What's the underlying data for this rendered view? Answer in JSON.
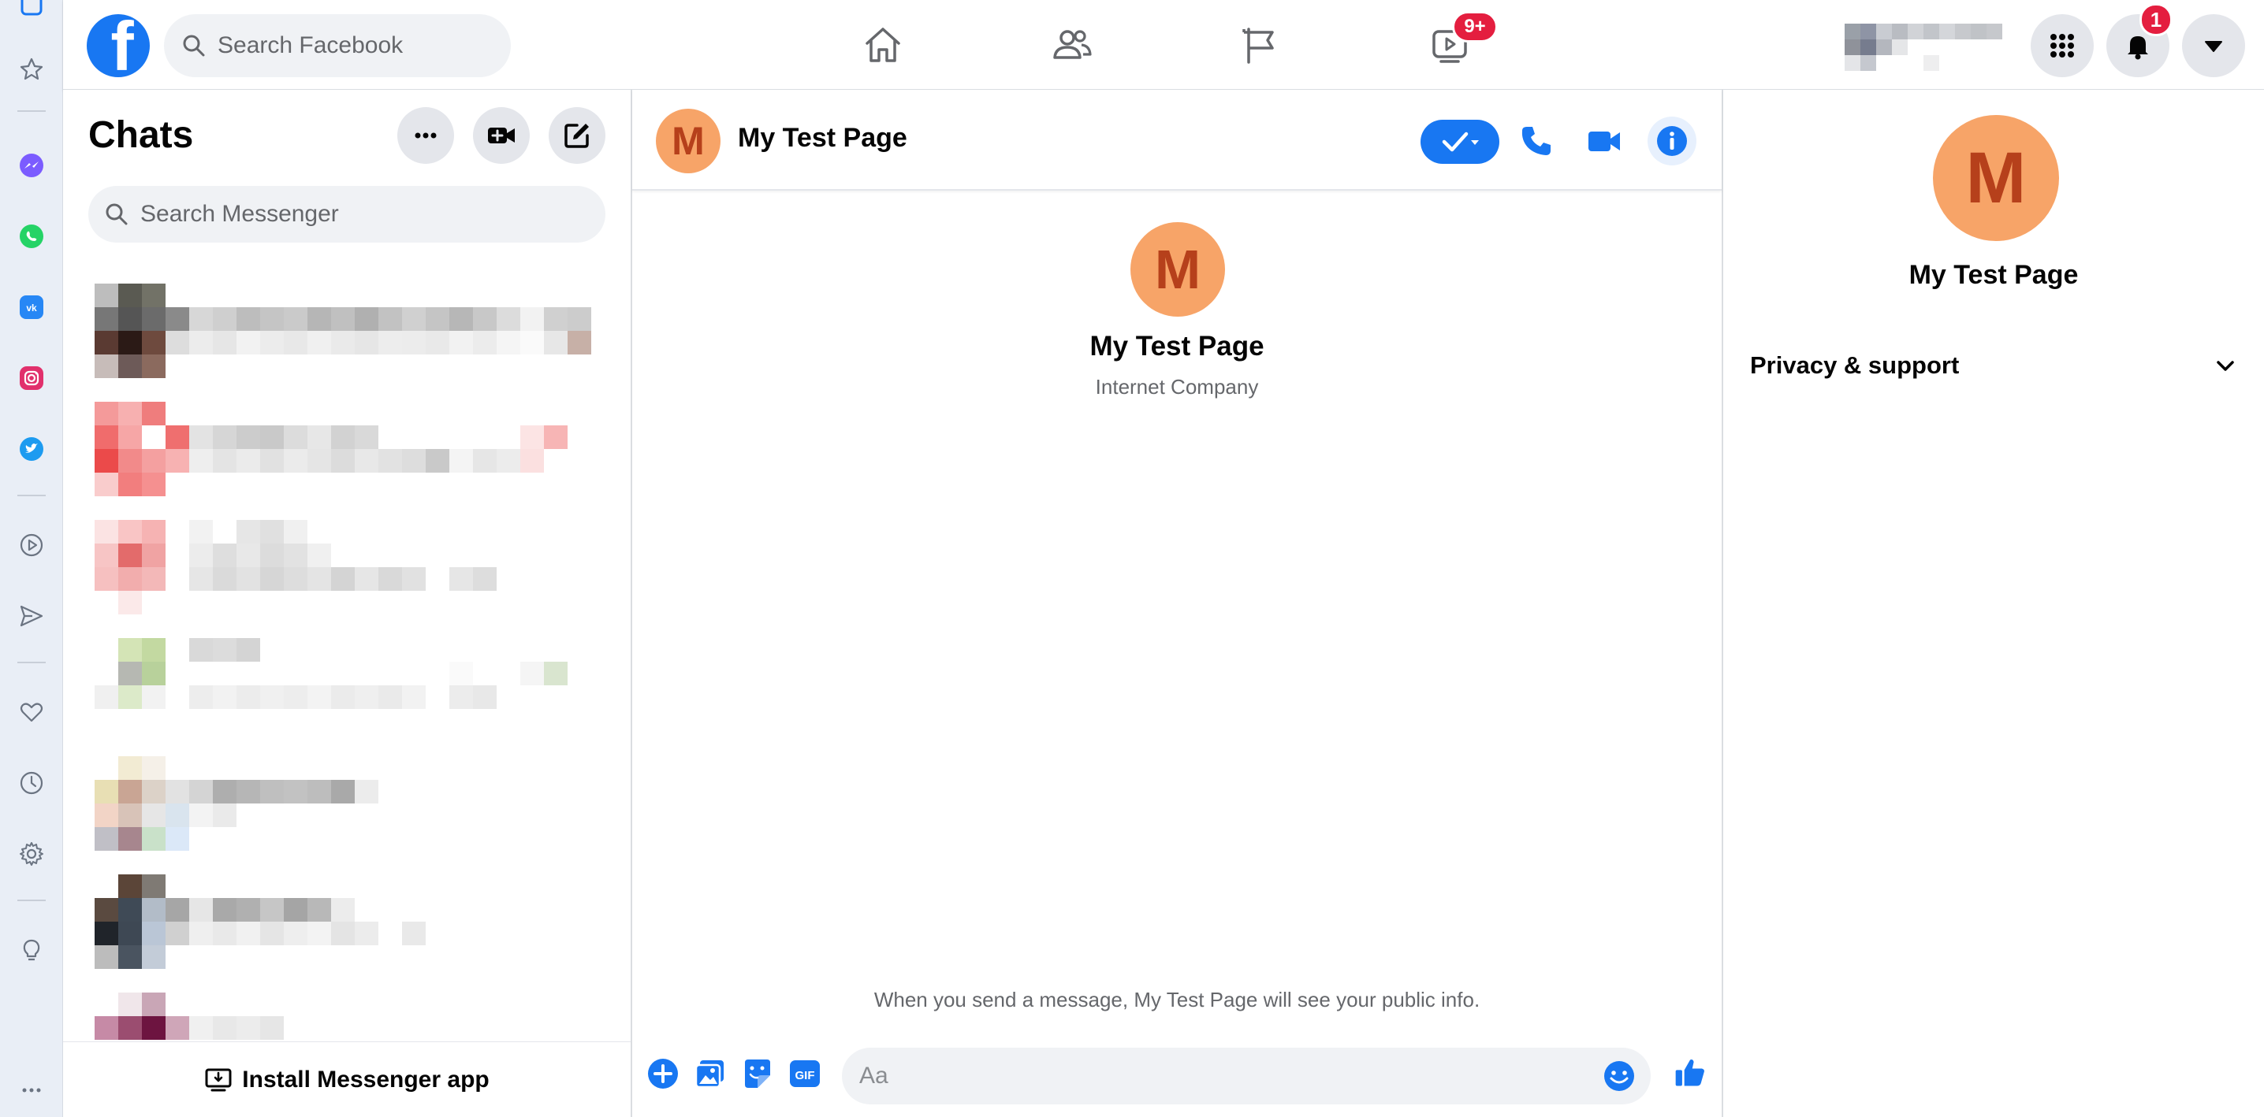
{
  "topbar": {
    "logo_letter": "f",
    "search_placeholder": "Search Facebook",
    "watch_badge": "9+",
    "notifications_badge": "1"
  },
  "chats": {
    "title": "Chats",
    "search_placeholder": "Search Messenger",
    "install_label": "Install Messenger app"
  },
  "conversation": {
    "avatar_letter": "M",
    "title": "My Test Page",
    "page_name": "My Test Page",
    "page_category": "Internet Company",
    "public_info_notice": "When you send a message, My Test Page will see your public info.",
    "composer_placeholder": "Aa"
  },
  "info_panel": {
    "avatar_letter": "M",
    "name": "My Test Page",
    "privacy_section": "Privacy & support"
  },
  "colors": {
    "brand_blue": "#1877f2",
    "badge_red": "#e41e3f",
    "avatar_orange": "#f7a468",
    "avatar_letter": "#b6401b"
  }
}
